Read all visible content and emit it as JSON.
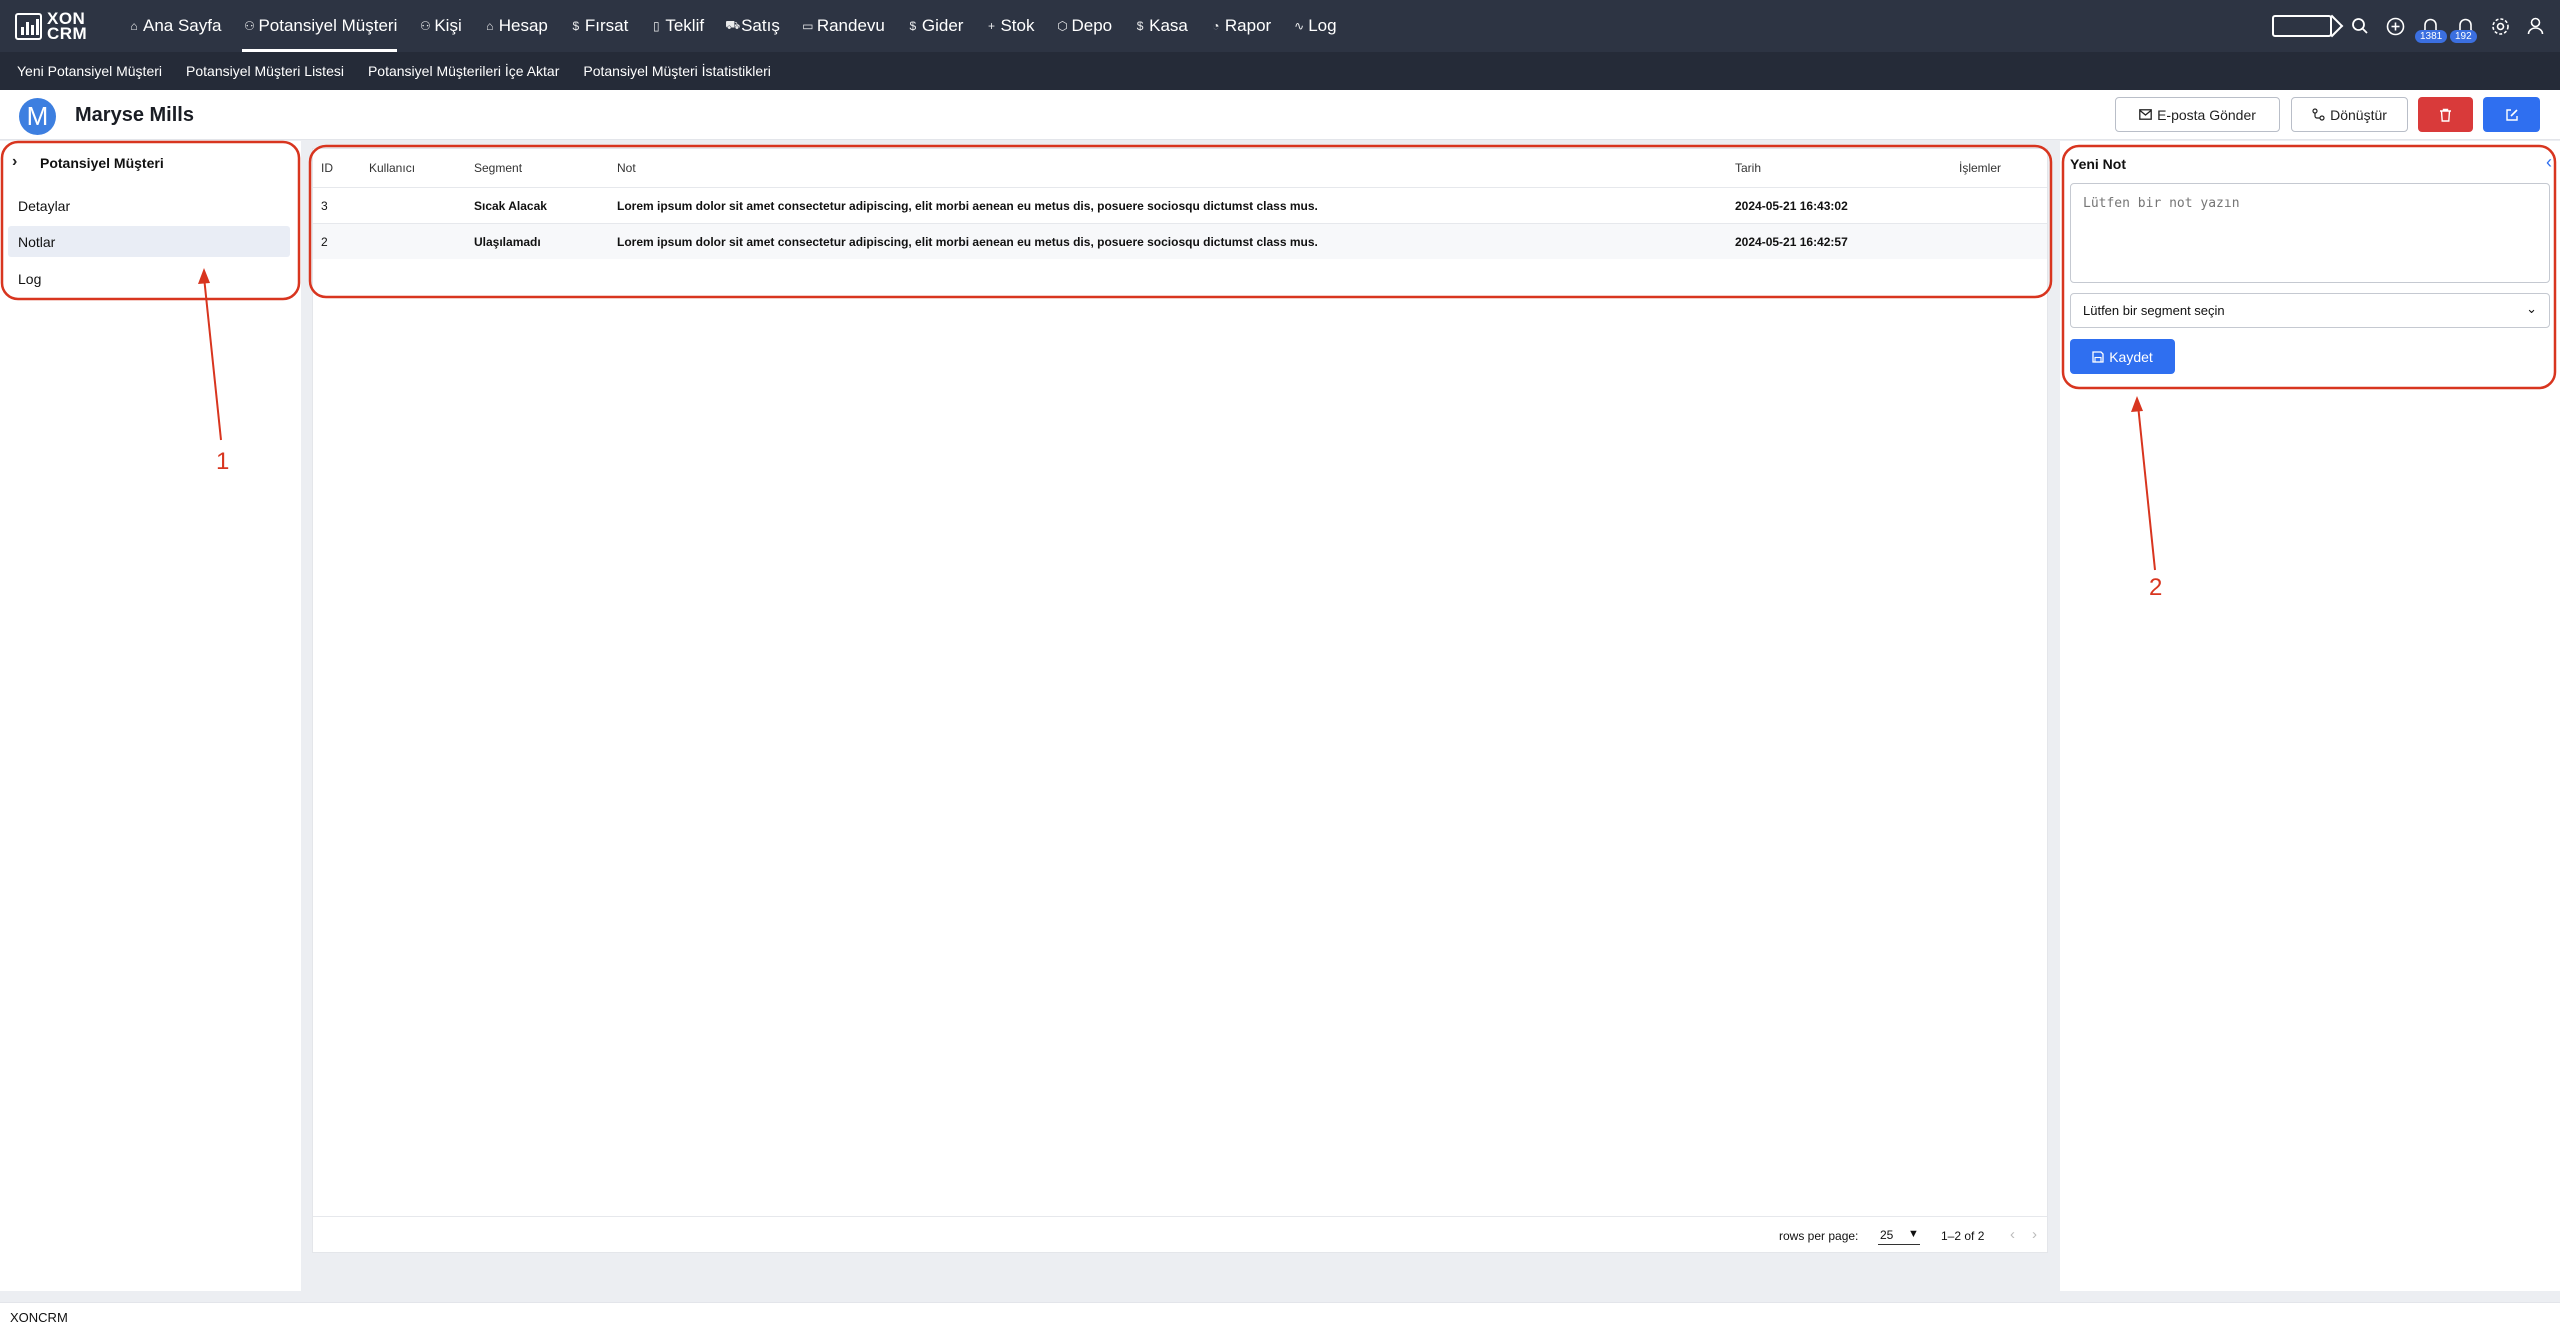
{
  "app": {
    "logo_line1": "XON",
    "logo_line2": "CRM"
  },
  "nav": {
    "items": [
      {
        "label": "Ana Sayfa",
        "icon": "home-icon",
        "glyph": "⌂"
      },
      {
        "label": "Potansiyel Müşteri",
        "icon": "user-icon",
        "glyph": "⚇"
      },
      {
        "label": "Kişi",
        "icon": "users-icon",
        "glyph": "⚇"
      },
      {
        "label": "Hesap",
        "icon": "building-icon",
        "glyph": "⌂"
      },
      {
        "label": "Fırsat",
        "icon": "dollar-icon",
        "glyph": "$"
      },
      {
        "label": "Teklif",
        "icon": "file-icon",
        "glyph": "▯"
      },
      {
        "label": "Satış",
        "icon": "cart-icon",
        "glyph": "⛟"
      },
      {
        "label": "Randevu",
        "icon": "calendar-icon",
        "glyph": "▭"
      },
      {
        "label": "Gider",
        "icon": "dollar-icon",
        "glyph": "$"
      },
      {
        "label": "Stok",
        "icon": "plus-icon",
        "glyph": "+"
      },
      {
        "label": "Depo",
        "icon": "box-icon",
        "glyph": "⬡"
      },
      {
        "label": "Kasa",
        "icon": "dollar-icon",
        "glyph": "$"
      },
      {
        "label": "Rapor",
        "icon": "pie-icon",
        "glyph": "◔"
      },
      {
        "label": "Log",
        "icon": "activity-icon",
        "glyph": "∿"
      }
    ],
    "active_index": 1,
    "notifications": {
      "badge1": "1381",
      "badge2": "192"
    }
  },
  "subnav": {
    "items": [
      "Yeni Potansiyel Müşteri",
      "Potansiyel Müşteri Listesi",
      "Potansiyel Müşterileri İçe Aktar",
      "Potansiyel Müşteri İstatistikleri"
    ]
  },
  "header": {
    "avatar_letter": "M",
    "title": "Maryse Mills",
    "email_button": "E-posta Gönder",
    "convert_button": "Dönüştür"
  },
  "sidebar": {
    "title": "Potansiyel Müşteri",
    "items": [
      "Detaylar",
      "Notlar",
      "Log"
    ],
    "active_index": 1
  },
  "table": {
    "headers": {
      "id": "ID",
      "user": "Kullanıcı",
      "segment": "Segment",
      "note": "Not",
      "date": "Tarih",
      "actions": "İşlemler"
    },
    "rows": [
      {
        "id": "3",
        "user": "",
        "segment": "Sıcak Alacak",
        "note": "Lorem ipsum dolor sit amet consectetur adipiscing, elit morbi aenean eu metus dis, posuere sociosqu dictumst class mus.",
        "date": "2024-05-21 16:43:02"
      },
      {
        "id": "2",
        "user": "",
        "segment": "Ulaşılamadı",
        "note": "Lorem ipsum dolor sit amet consectetur adipiscing, elit morbi aenean eu metus dis, posuere sociosqu dictumst class mus.",
        "date": "2024-05-21 16:42:57"
      }
    ],
    "footer": {
      "rows_per_page_label": "rows per page:",
      "rows_per_page": "25",
      "range": "1–2 of 2"
    }
  },
  "note_panel": {
    "title": "Yeni Not",
    "textarea_placeholder": "Lütfen bir not yazın",
    "segment_placeholder": "Lütfen bir segment seçin",
    "save_button": "Kaydet"
  },
  "footer": {
    "text": "XONCRM"
  },
  "annotations": {
    "label1": "1",
    "label2": "2",
    "color": "#d8351f"
  },
  "colors": {
    "nav_bg": "#2d3443",
    "subnav_bg": "#252b38",
    "primary": "#2f6ff0",
    "danger": "#d93a3a"
  }
}
